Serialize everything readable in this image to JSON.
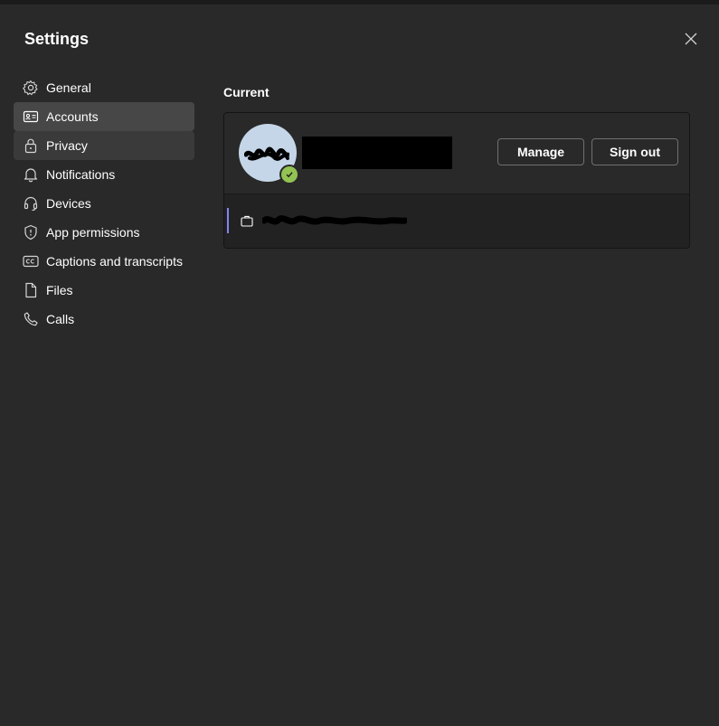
{
  "dialog": {
    "title": "Settings",
    "close_icon": "close-icon"
  },
  "sidebar": {
    "items": [
      {
        "label": "General",
        "icon": "gear-icon"
      },
      {
        "label": "Accounts",
        "icon": "contact-card-icon",
        "selected": true
      },
      {
        "label": "Privacy",
        "icon": "lock-icon"
      },
      {
        "label": "Notifications",
        "icon": "bell-icon"
      },
      {
        "label": "Devices",
        "icon": "headset-icon"
      },
      {
        "label": "App permissions",
        "icon": "shield-icon"
      },
      {
        "label": "Captions and transcripts",
        "icon": "closed-captions-icon"
      },
      {
        "label": "Files",
        "icon": "file-icon"
      },
      {
        "label": "Calls",
        "icon": "phone-icon"
      }
    ]
  },
  "accounts": {
    "section_heading": "Current",
    "account": {
      "presence": "available",
      "manage_label": "Manage",
      "signout_label": "Sign out",
      "org_icon": "briefcase-icon"
    }
  },
  "colors": {
    "dialog_bg": "#292929",
    "selected_item_bg": "#474747",
    "presence_available": "#92c353",
    "accent": "#7f85f5"
  }
}
